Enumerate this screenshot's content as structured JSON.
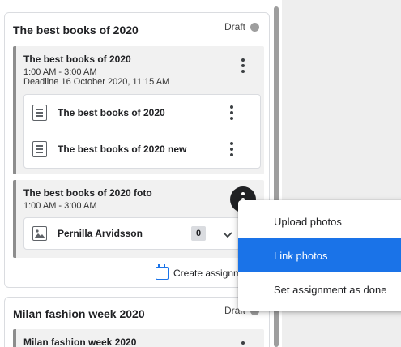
{
  "colors": {
    "accent": "#1a73e8",
    "draft_dot": "#9e9e9e",
    "section_border": "#8d8d8d"
  },
  "card1": {
    "title": "The best books of 2020",
    "status": "Draft",
    "section1": {
      "title": "The best books of 2020",
      "time": "1:00 AM - 3:00 AM",
      "deadline": "Deadline 16 October 2020, 11:15 AM",
      "files": [
        {
          "name": "The best books of 2020",
          "icon": "document-icon"
        },
        {
          "name": "The best books of 2020 new",
          "icon": "document-icon"
        }
      ]
    },
    "section2": {
      "title": "The best books of 2020 foto",
      "time": "1:00 AM - 3:00 AM",
      "student": {
        "name": "Pernilla Arvidsson",
        "count": "0",
        "icon": "image-icon"
      }
    },
    "create_label": "Create assignm"
  },
  "card2": {
    "title": "Milan fashion week 2020",
    "status": "Draft",
    "section": {
      "title": "Milan fashion week 2020"
    }
  },
  "menu": {
    "items": [
      {
        "label": "Upload photos"
      },
      {
        "label": "Link photos",
        "highlighted": true
      },
      {
        "label": "Set assignment as done"
      }
    ]
  }
}
